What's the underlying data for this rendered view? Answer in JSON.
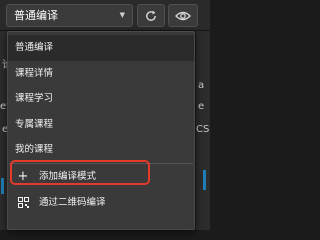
{
  "toolbar": {
    "mode_select": "普通编译",
    "caret_icon": "triangle-down",
    "refresh_icon": "refresh",
    "preview_icon": "eye"
  },
  "background": {
    "left_fragments": [
      "论",
      "ev",
      "e"
    ],
    "right_fragments": [
      "a",
      "e",
      "CS"
    ]
  },
  "menu": {
    "items": [
      {
        "label": "普通编译",
        "active": true
      },
      {
        "label": "课程详情"
      },
      {
        "label": "课程学习"
      },
      {
        "label": "专属课程"
      },
      {
        "label": "我的课程"
      },
      {
        "label": "添加编译模式",
        "icon": "plus"
      },
      {
        "label": "通过二维码编译",
        "icon": "qrcode"
      }
    ]
  },
  "colors": {
    "highlight_border": "#e43a2a",
    "menu_bg": "#3a3a3a",
    "active_item_bg": "#2b2b2b"
  }
}
